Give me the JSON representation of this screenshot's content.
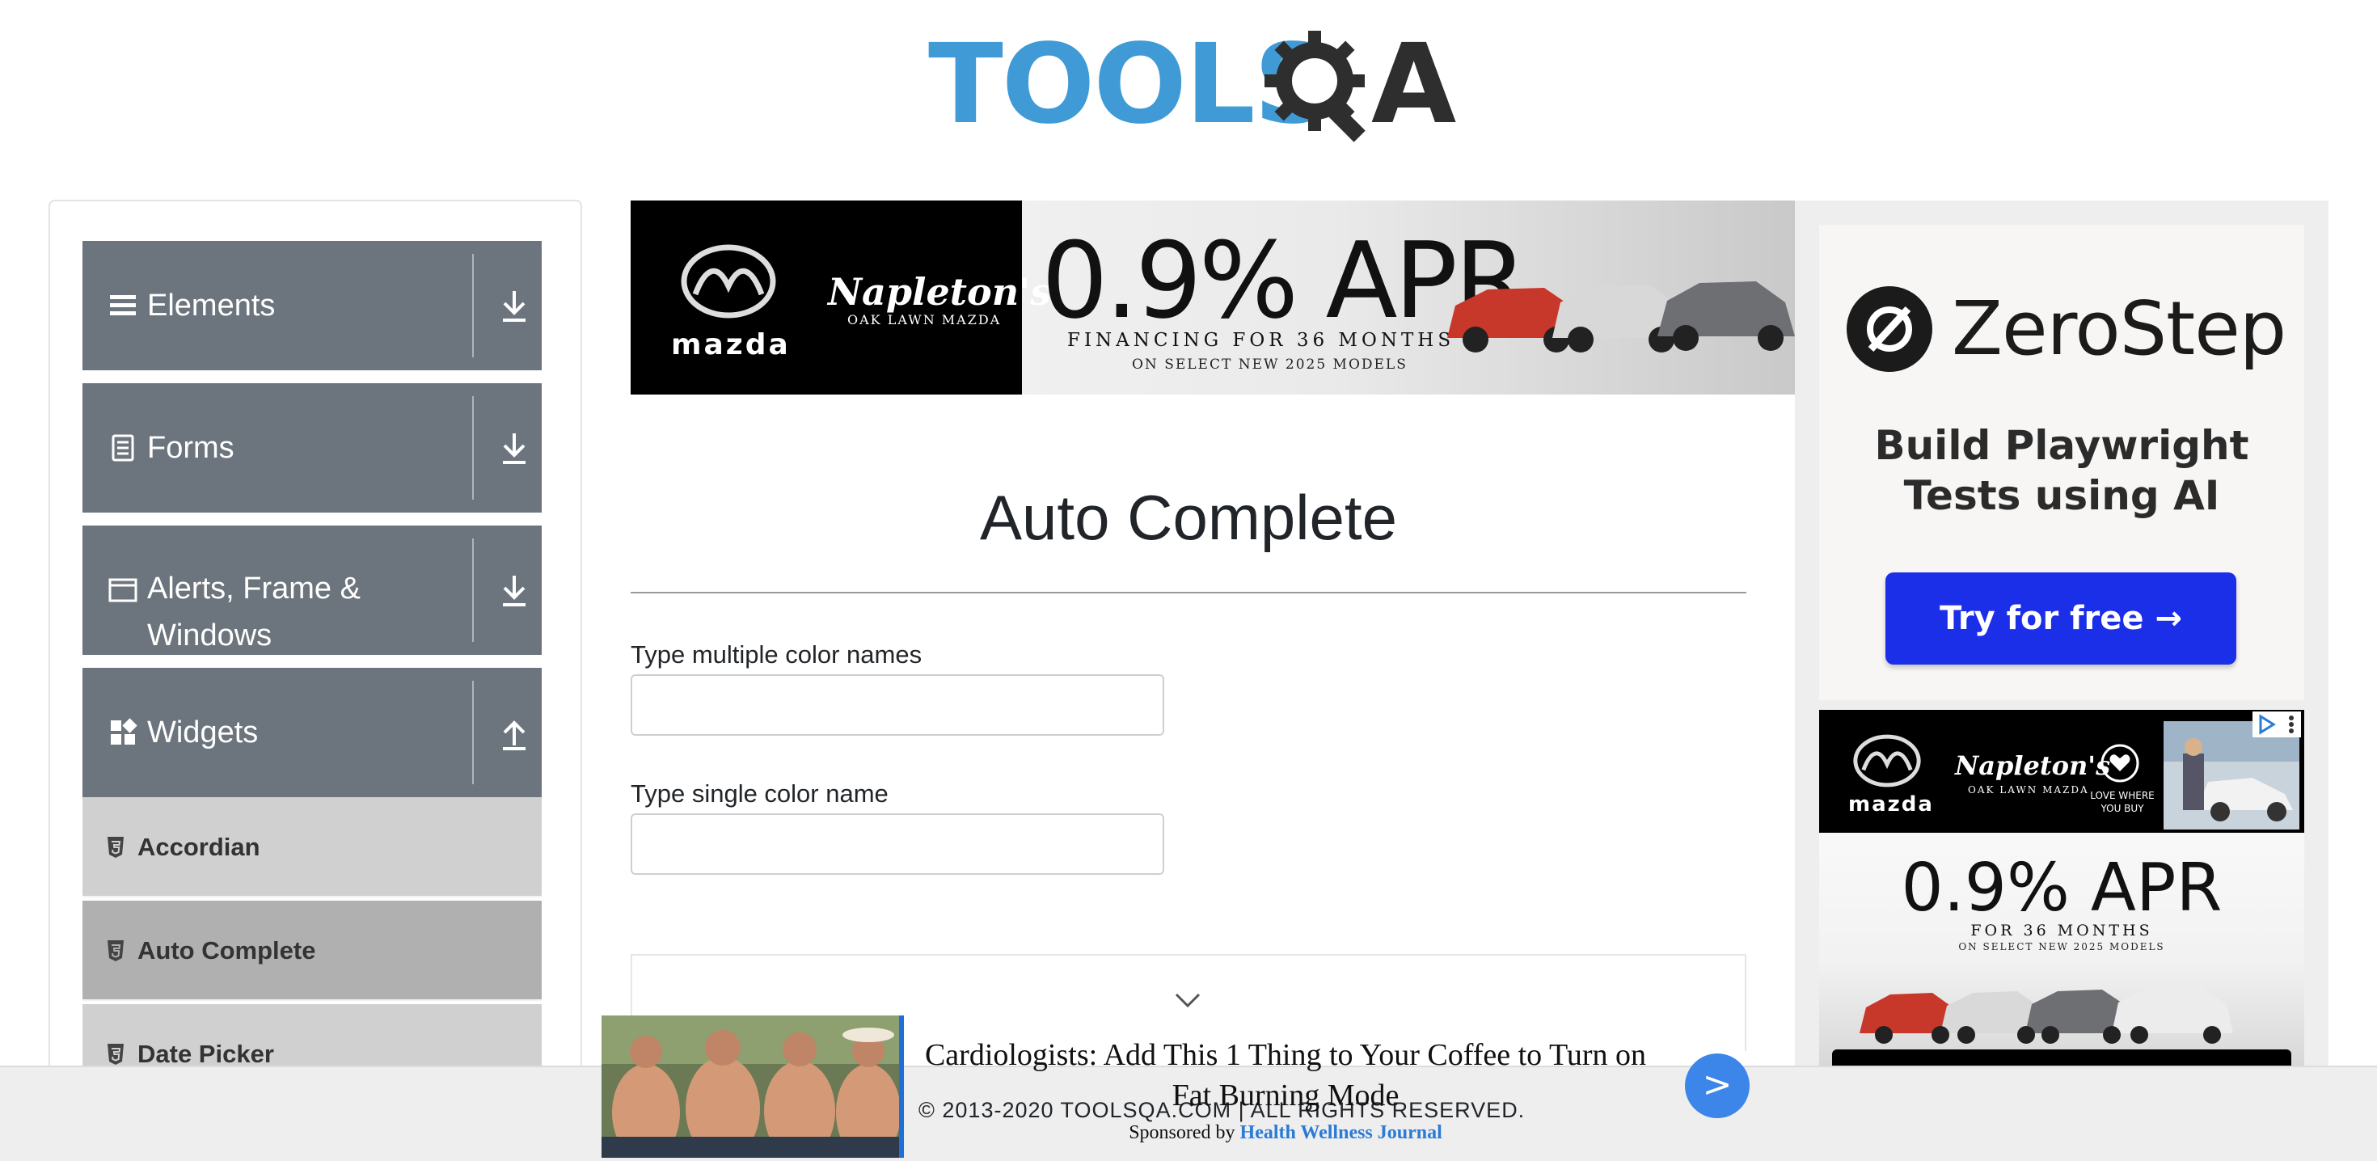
{
  "logo": {
    "text": "TOOLS",
    "text_after": "A",
    "alt": "TOOLSQA"
  },
  "sidebar": {
    "groups": [
      {
        "label": "Elements",
        "icon": "list-icon",
        "expanded": false
      },
      {
        "label": "Forms",
        "icon": "form-icon",
        "expanded": false
      },
      {
        "label": "Alerts, Frame &",
        "label_line2": "Windows",
        "icon": "window-icon",
        "expanded": false
      },
      {
        "label": "Widgets",
        "icon": "widgets-icon",
        "expanded": true
      }
    ],
    "items": [
      {
        "label": "Accordian",
        "active": false
      },
      {
        "label": "Auto Complete",
        "active": true
      },
      {
        "label": "Date Picker",
        "active": false
      }
    ]
  },
  "banner_ad": {
    "brand": "mazda",
    "dealer": "Napleton's",
    "dealer_sub": "OAK LAWN MAZDA",
    "apr": "0.9% APR",
    "line1": "FINANCING FOR 36 MONTHS",
    "line2": "ON SELECT NEW 2025 MODELS"
  },
  "main": {
    "title": "Auto Complete",
    "fields": [
      {
        "label": "Type multiple color names",
        "value": "",
        "placeholder": ""
      },
      {
        "label": "Type single color name",
        "value": "",
        "placeholder": ""
      }
    ]
  },
  "right_ad": {
    "brand": "ZeroStep",
    "tagline_line1": "Build Playwright",
    "tagline_line2": "Tests using AI",
    "cta": "Try for free →",
    "ad2": {
      "brand": "mazda",
      "dealer": "Napleton's",
      "dealer_sub": "OAK LAWN MAZDA",
      "love": "LOVE WHERE YOU BUY",
      "apr": "0.9% APR",
      "line1": "FOR 36 MONTHS",
      "line2": "ON SELECT NEW 2025 MODELS"
    }
  },
  "footer": {
    "copyright": "© 2013-2020 TOOLSQA.COM | ALL RIGHTS RESERVED."
  },
  "native_ad": {
    "headline": "Cardiologists: Add This 1 Thing to Your Coffee to Turn on Fat Burning Mode",
    "sponsored_by": "Sponsored by",
    "sponsor": "Health Wellness Journal",
    "next_label": ">"
  },
  "colors": {
    "sidebar_header": "#6c757d",
    "sidebar_item": "#d0d0d0",
    "sidebar_item_active": "#b0b0b0",
    "logo_blue": "#3f9ad6",
    "cta_blue": "#1b2ee8",
    "arrow_blue": "#3b86e8"
  }
}
